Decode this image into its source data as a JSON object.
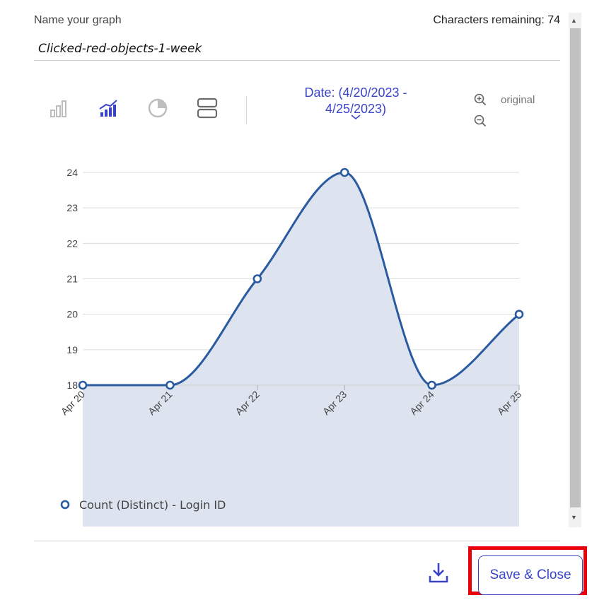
{
  "form": {
    "name_label": "Name your graph",
    "chars_remaining": "Characters remaining: 74",
    "graph_name": "Clicked-red-objects-1-week"
  },
  "toolbar": {
    "icons": [
      "bar-chart-icon",
      "area-chart-icon",
      "pie-chart-icon",
      "table-view-icon"
    ],
    "date_label": "Date: (4/20/2023 -",
    "date_label_line2": "4/25/2023)",
    "zoom_in_icon": "zoom-in-icon",
    "zoom_out_icon": "zoom-out-icon",
    "original_label": "original",
    "accent_color": "#3a44c8",
    "inactive_color": "#bdbdbd"
  },
  "chart_data": {
    "type": "area",
    "x": [
      "Apr 20",
      "Apr 21",
      "Apr 22",
      "Apr 23",
      "Apr 24",
      "Apr 25"
    ],
    "series": [
      {
        "name": "Count (Distinct) - Login ID",
        "values": [
          18,
          18,
          21,
          24,
          18,
          20
        ],
        "color": "#2a5ba0",
        "fill": "#dbe3ef"
      }
    ],
    "y_ticks": [
      18,
      19,
      20,
      21,
      22,
      23,
      24
    ],
    "ylim": [
      18,
      24
    ],
    "grid": true,
    "legend_position": "bottom-left"
  },
  "footer": {
    "download_icon": "download-icon",
    "save_close_label": "Save & Close",
    "highlight_color": "#e8000b"
  }
}
